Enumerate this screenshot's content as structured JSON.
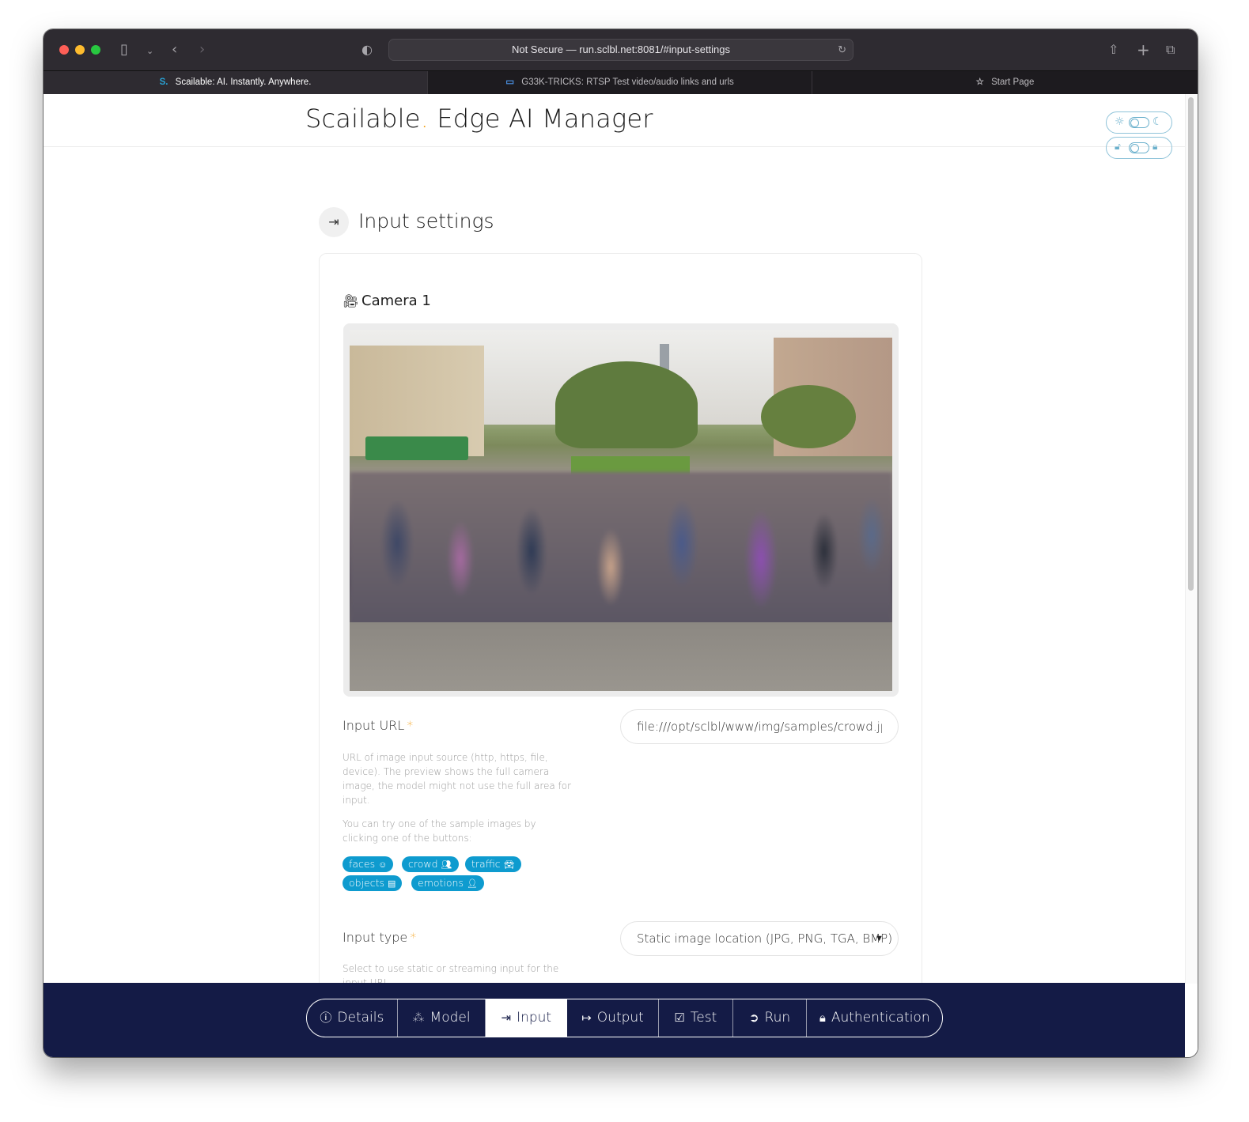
{
  "browser": {
    "url_text": "Not Secure — run.sclbl.net:8081/#input-settings",
    "tabs": [
      {
        "label": "Scailable: AI. Instantly. Anywhere.",
        "icon": "S",
        "active": true
      },
      {
        "label": "G33K-TRICKS: RTSP Test video/audio links and urls",
        "icon": "monitor-icon",
        "active": false
      },
      {
        "label": "Start Page",
        "icon": "star-icon",
        "active": false
      }
    ]
  },
  "header": {
    "brand_main": "Scailable",
    "brand_dot": ".",
    "brand_rest": " Edge AI Manager"
  },
  "section": {
    "title": "Input settings"
  },
  "camera": {
    "title": "Camera 1"
  },
  "input_url": {
    "label": "Input URL",
    "required_mark": "*",
    "value": "file:///opt/sclbl/www/img/samples/crowd.jpg",
    "help": "URL of image input source (http, https, file, device). The preview shows the full camera image, the model might not use the full area for input.",
    "help2": "You can try one of the sample images by clicking one of the buttons:",
    "samples": [
      "faces",
      "crowd",
      "traffic",
      "objects",
      "emotions"
    ]
  },
  "input_type": {
    "label": "Input type",
    "required_mark": "*",
    "value": "Static image location (JPG, PNG, TGA, BMP)",
    "help": "Select to use static or streaming input for the input URL"
  },
  "nav": {
    "items": [
      {
        "label": "Details",
        "icon": "info-icon"
      },
      {
        "label": "Model",
        "icon": "sitemap-icon"
      },
      {
        "label": "Input",
        "icon": "sign-in-icon",
        "active": true
      },
      {
        "label": "Output",
        "icon": "sign-out-icon"
      },
      {
        "label": "Test",
        "icon": "checklist-icon"
      },
      {
        "label": "Run",
        "icon": "arrow-circle-icon"
      },
      {
        "label": "Authentication",
        "icon": "lock-icon"
      }
    ]
  },
  "colors": {
    "accent": "#0e9bcf",
    "brand_dot": "#f5a623",
    "nav_bg": "#141b46"
  }
}
